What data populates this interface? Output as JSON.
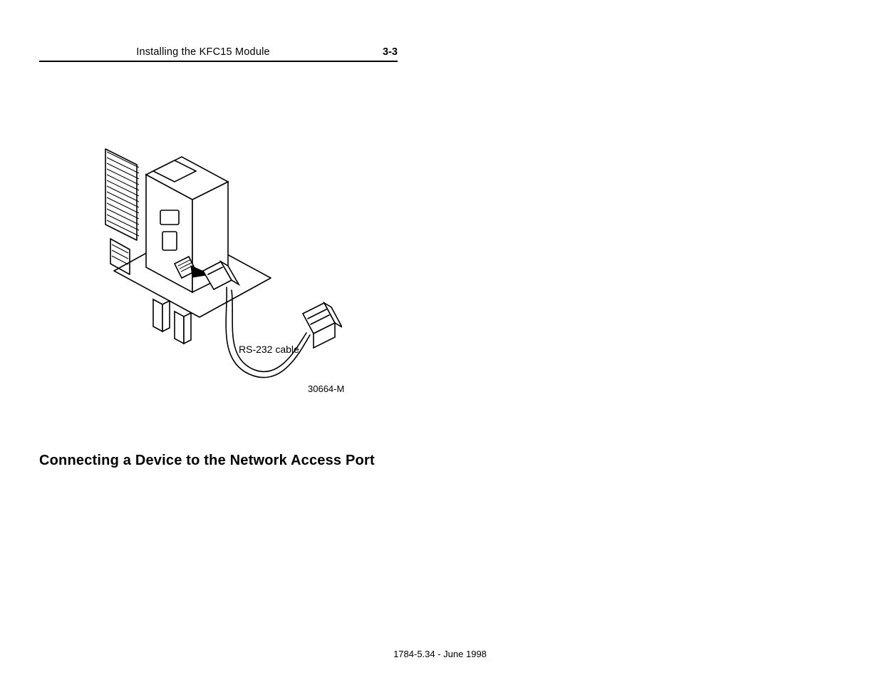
{
  "header": {
    "title": "Installing the KFC15 Module",
    "page_number": "3-3"
  },
  "figure": {
    "cable_label": "RS-232 cable",
    "figure_id": "30664-M"
  },
  "section": {
    "heading": "Connecting a Device to the Network Access Port"
  },
  "footer": {
    "text": "1784-5.34 - June 1998"
  },
  "chart_data": {
    "type": "diagram",
    "description": "Line drawing of a KFC15 communication module with an RS-232 cable connecting from the module's serial port to an external connector.",
    "labels": [
      "RS-232 cable"
    ],
    "figure_reference": "30664-M"
  }
}
